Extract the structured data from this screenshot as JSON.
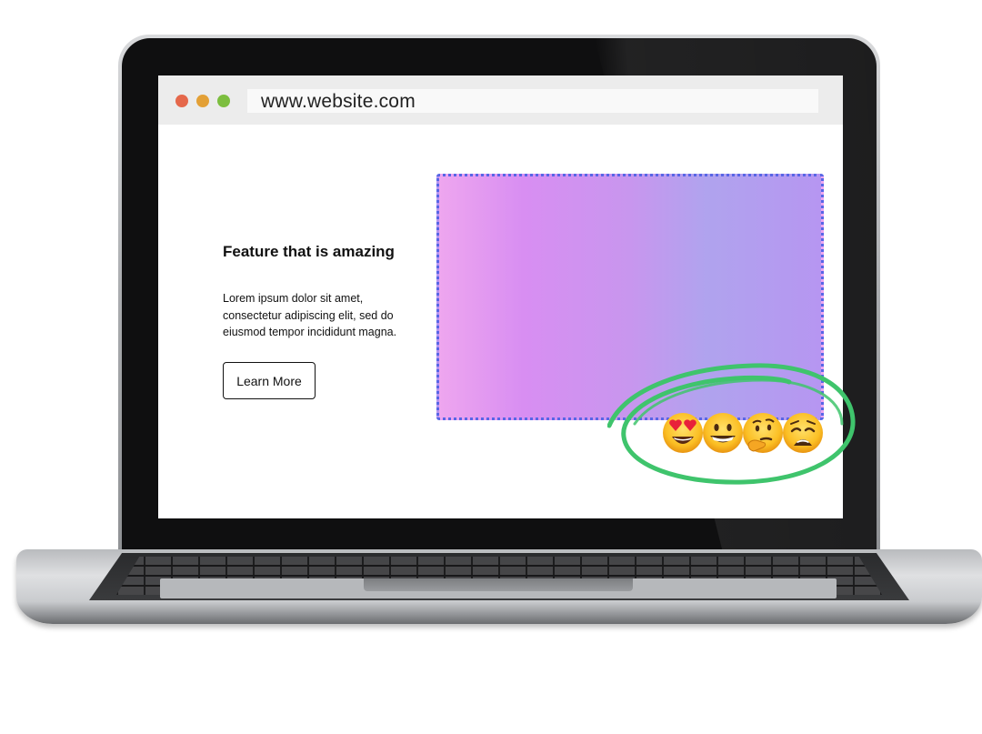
{
  "browser": {
    "url": "www.website.com"
  },
  "feature": {
    "title": "Feature that is amazing",
    "body": "Lorem ipsum dolor sit amet, consectetur adipiscing elit, sed do eiusmod tempor incididunt magna.",
    "button_label": "Learn More"
  },
  "colors": {
    "window_red": "#e5684b",
    "window_yellow": "#e3a036",
    "window_green": "#7cbe3f",
    "frame_border": "#5866e6",
    "gradient_start": "#eea6ef",
    "gradient_end": "#b696f1",
    "highlight_circle": "#3fc46c"
  },
  "reactions": [
    {
      "icon": "heart-eyes-emoji"
    },
    {
      "icon": "grinning-emoji"
    },
    {
      "icon": "thinking-emoji"
    },
    {
      "icon": "weary-emoji"
    }
  ]
}
